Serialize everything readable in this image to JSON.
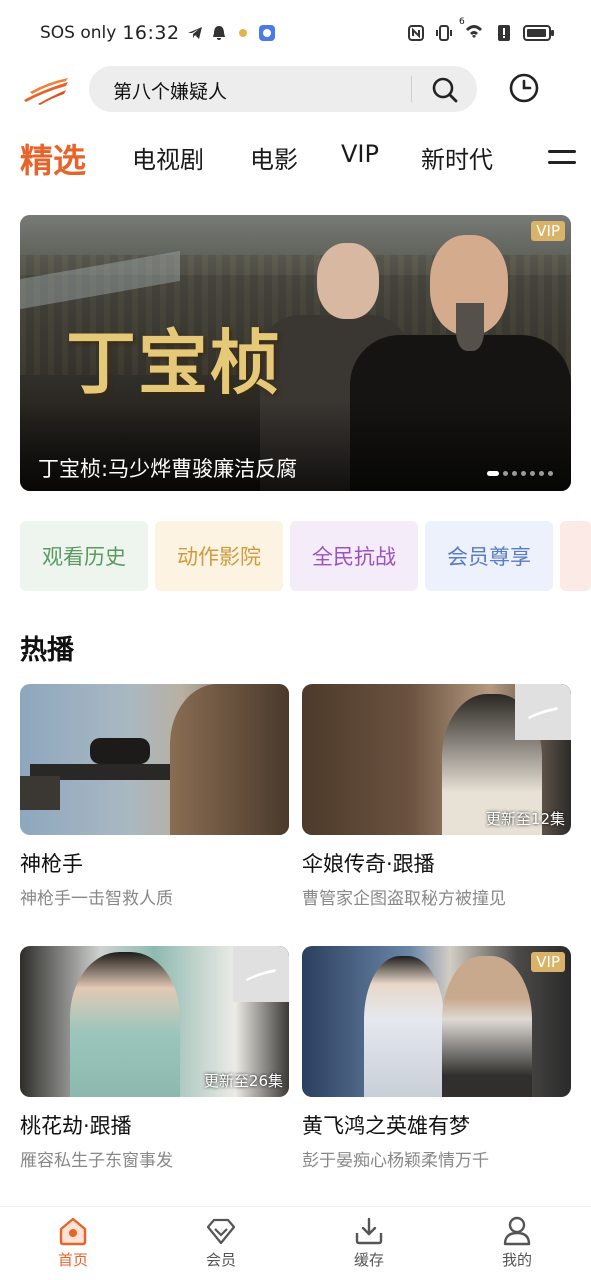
{
  "status_bar": {
    "carrier": "SOS only",
    "time": "16:32",
    "network_label": "6"
  },
  "search": {
    "query": "第八个嫌疑人"
  },
  "tabs": [
    {
      "label": "精选",
      "active": true
    },
    {
      "label": "电视剧"
    },
    {
      "label": "电影"
    },
    {
      "label": "VIP"
    },
    {
      "label": "新时代"
    }
  ],
  "banner": {
    "title_art": "丁宝桢",
    "badge": "VIP",
    "caption": "丁宝桢:马少烨曹骏廉洁反腐"
  },
  "categories": [
    "观看历史",
    "动作影院",
    "全民抗战",
    "会员尊享"
  ],
  "hot": {
    "title": "热播",
    "items": [
      {
        "title": "神枪手",
        "subtitle": "神枪手一击智救人质",
        "update": ""
      },
      {
        "title": "伞娘传奇·跟播",
        "subtitle": "曹管家企图盗取秘方被撞见",
        "update": "更新至12集"
      },
      {
        "title": "桃花劫·跟播",
        "subtitle": "雁容私生子东窗事发",
        "update": "更新至26集"
      },
      {
        "title": "黄飞鸿之英雄有梦",
        "subtitle": "彭于晏痴心杨颖柔情万千",
        "update": "",
        "badge": "VIP"
      }
    ]
  },
  "bottom_nav": [
    {
      "label": "首页",
      "icon": "home-icon",
      "active": true
    },
    {
      "label": "会员",
      "icon": "vip-diamond-icon"
    },
    {
      "label": "缓存",
      "icon": "download-icon"
    },
    {
      "label": "我的",
      "icon": "profile-icon"
    }
  ],
  "colors": {
    "accent": "#e8632a",
    "vip_gold": "#d9b36a"
  }
}
